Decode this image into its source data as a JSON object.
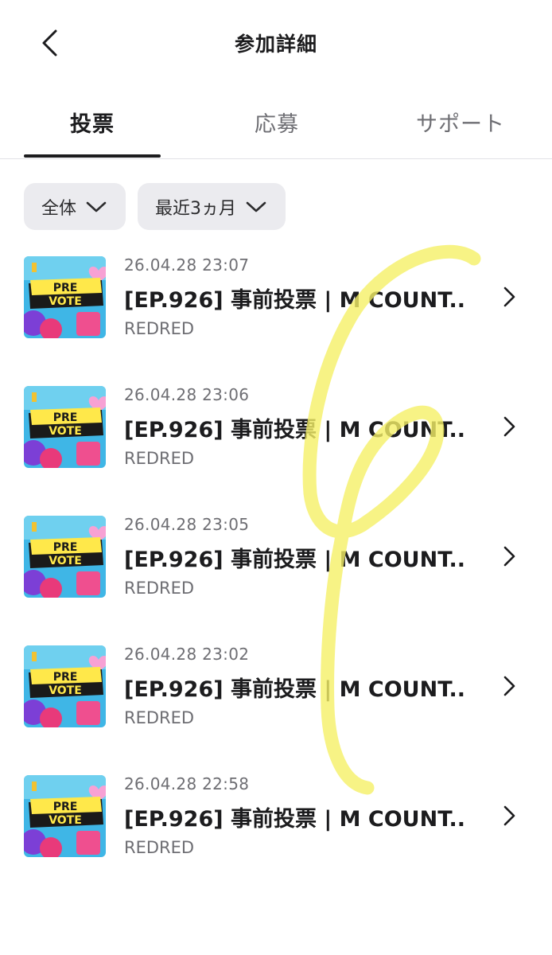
{
  "header": {
    "title": "参加詳細",
    "back_icon": "chevron-left-icon"
  },
  "tabs": [
    {
      "label": "投票",
      "active": true
    },
    {
      "label": "応募",
      "active": false
    },
    {
      "label": "サポート",
      "active": false
    }
  ],
  "filters": [
    {
      "label": "全体",
      "icon": "chevron-down-icon"
    },
    {
      "label": "最近3ヵ月",
      "icon": "chevron-down-icon"
    }
  ],
  "thumbnail": {
    "line1": "PRE",
    "line2": "VOTE"
  },
  "items": [
    {
      "date": "26.04.28 23:07",
      "title": "[EP.926] 事前投票 | M COUNT...",
      "subtitle": "REDRED"
    },
    {
      "date": "26.04.28 23:06",
      "title": "[EP.926] 事前投票 | M COUNT...",
      "subtitle": "REDRED"
    },
    {
      "date": "26.04.28 23:05",
      "title": "[EP.926] 事前投票 | M COUNT...",
      "subtitle": "REDRED"
    },
    {
      "date": "26.04.28 23:02",
      "title": "[EP.926] 事前投票 | M COUNT...",
      "subtitle": "REDRED"
    },
    {
      "date": "26.04.28 22:58",
      "title": "[EP.926] 事前投票 | M COUNT...",
      "subtitle": "REDRED"
    }
  ],
  "colors": {
    "accent": "#1c1c1e",
    "muted": "#6e6e73",
    "filter_bg": "#ebebef",
    "highlighter": "#f5f067"
  }
}
